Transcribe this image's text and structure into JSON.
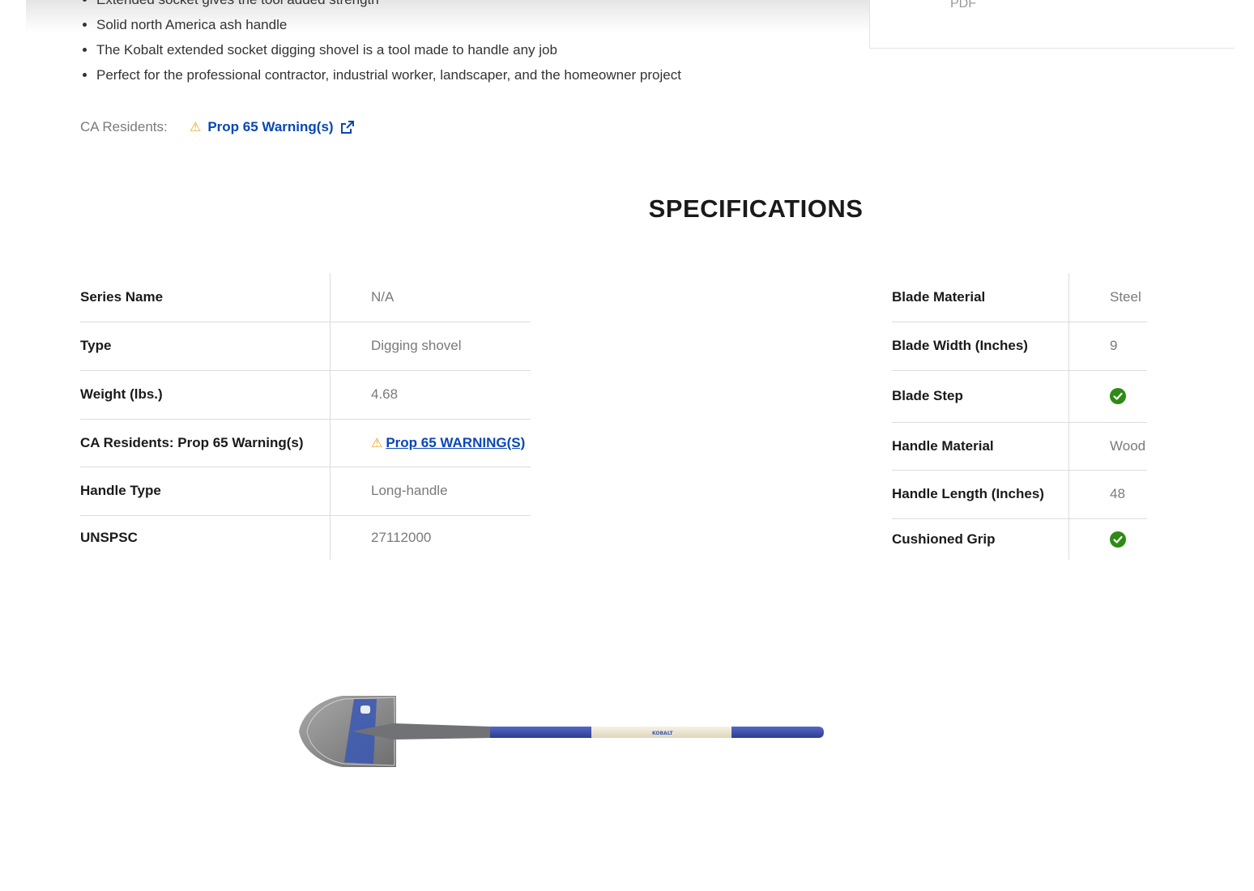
{
  "side_panel": {
    "pdf_label": "PDF"
  },
  "features": [
    "Extended socket gives the tool added strength",
    "Solid north America ash handle",
    "The Kobalt extended socket digging shovel is a tool made to handle any job",
    "Perfect for the professional contractor, industrial worker, landscaper, and the homeowner project"
  ],
  "ca_residents": {
    "label": "CA Residents:",
    "warning_icon": "warning-triangle-icon",
    "link_text": "Prop 65 Warning(s)",
    "link_icon": "external-link-icon"
  },
  "specifications": {
    "title": "SPECIFICATIONS",
    "left": [
      {
        "key": "Series Name",
        "value": "N/A"
      },
      {
        "key": "Type",
        "value": "Digging shovel"
      },
      {
        "key": "Weight (lbs.)",
        "value": "4.68"
      },
      {
        "key": "CA Residents: Prop 65 Warning(s)",
        "value": "Prop 65 WARNING(S)"
      },
      {
        "key": "Handle Type",
        "value": "Long-handle"
      },
      {
        "key": "UNSPSC",
        "value": "27112000"
      }
    ],
    "right": [
      {
        "key": "Blade Material",
        "value": "Steel"
      },
      {
        "key": "Blade Width (Inches)",
        "value": "9"
      },
      {
        "key": "Blade Step",
        "value": "check-icon"
      },
      {
        "key": "Handle Material",
        "value": "Wood"
      },
      {
        "key": "Handle Length (Inches)",
        "value": "48"
      },
      {
        "key": "Cushioned Grip",
        "value": "check-icon"
      }
    ]
  },
  "product_image": {
    "brand_text": "KOBALT"
  },
  "colors": {
    "link": "#0a47b5",
    "warning": "#e7a41a",
    "check": "#2f8a16",
    "handle_blue": "#3d4fb0"
  }
}
